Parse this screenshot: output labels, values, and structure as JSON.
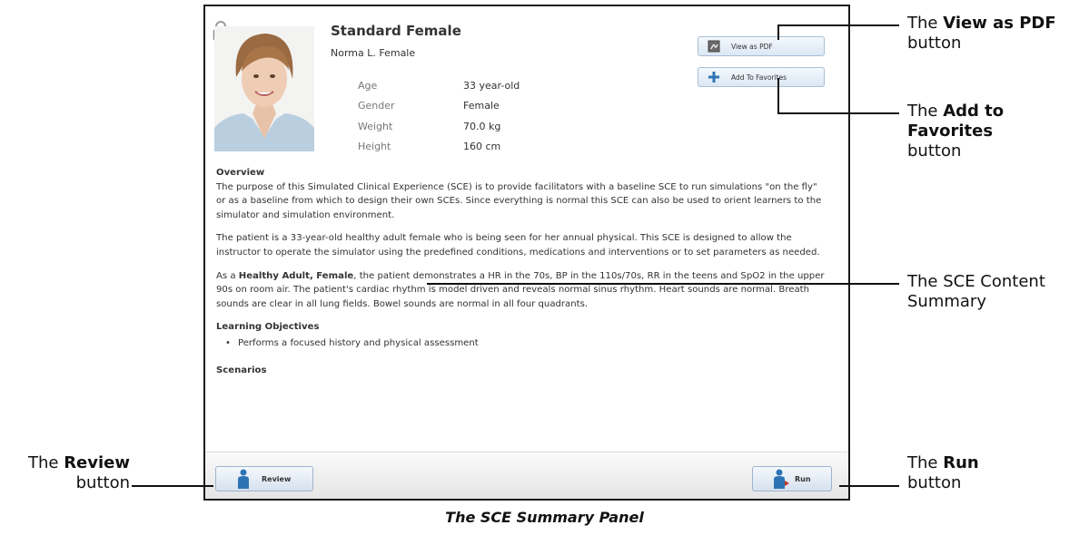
{
  "panel": {
    "title": "Standard Female",
    "name": "Norma L. Female",
    "vitals": [
      {
        "label": "Age",
        "value": "33 year-old"
      },
      {
        "label": "Gender",
        "value": "Female"
      },
      {
        "label": "Weight",
        "value": "70.0 kg"
      },
      {
        "label": "Height",
        "value": "160 cm"
      }
    ],
    "buttons": {
      "view_pdf": "View as PDF",
      "add_favorites": "Add To Favorites",
      "review": "Review",
      "run": "Run"
    },
    "overview_heading": "Overview",
    "overview_p1": "The purpose of this Simulated Clinical Experience (SCE) is to provide facilitators with a baseline SCE to run simulations \"on the fly\" or as a baseline from which to design their own SCEs. Since everything is normal this SCE can also be used to orient learners to the simulator and simulation environment.",
    "overview_p2": "The patient is a 33-year-old healthy adult female who is being seen for her annual physical. This SCE is designed to allow the instructor to operate the simulator using the predefined conditions, medications and interventions or to set parameters as needed.",
    "overview_p3_prefix": "As a ",
    "overview_p3_bold": "Healthy Adult, Female",
    "overview_p3_rest": ", the patient demonstrates a HR in the 70s, BP in the 110s/70s, RR in the teens and SpO2 in the upper 90s on room air. The patient's cardiac rhythm is model driven and reveals normal sinus rhythm. Heart sounds are normal. Breath sounds are clear in all lung fields. Bowel sounds are normal in all four quadrants.",
    "objectives_heading": "Learning Objectives",
    "objectives": [
      "Performs a focused history and physical assessment"
    ],
    "scenarios_heading": "Scenarios"
  },
  "callouts": {
    "pdf_pre": "The ",
    "pdf_bold": "View as PDF",
    "pdf_post": "button",
    "fav_pre": "The ",
    "fav_bold1": "Add to",
    "fav_bold2": "Favorites",
    "fav_post": "button",
    "summary_line1": "The SCE Content",
    "summary_line2": "Summary",
    "review_pre": "The ",
    "review_bold": "Review",
    "review_post": "button",
    "run_pre": "The ",
    "run_bold": "Run",
    "run_post": "button"
  },
  "caption": "The SCE Summary Panel",
  "icons": [
    "lock-icon",
    "pdf-icon",
    "plus-icon",
    "person-icon",
    "run-person-icon"
  ]
}
